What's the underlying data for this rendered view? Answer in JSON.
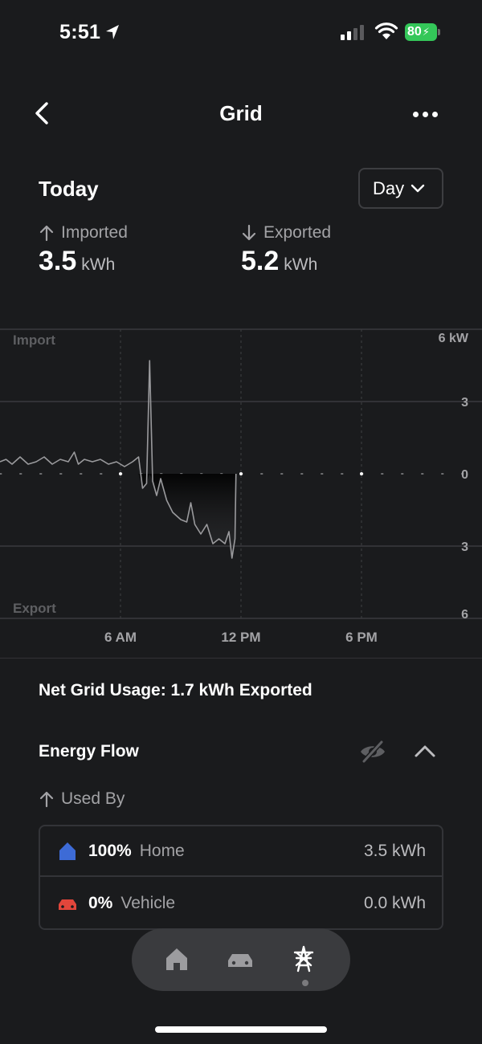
{
  "status": {
    "time": "5:51",
    "battery": "80"
  },
  "header": {
    "title": "Grid"
  },
  "period": {
    "label": "Today",
    "select_value": "Day"
  },
  "stats": {
    "imported": {
      "label": "Imported",
      "value": "3.5",
      "unit": "kWh"
    },
    "exported": {
      "label": "Exported",
      "value": "5.2",
      "unit": "kWh"
    }
  },
  "chart_data": {
    "type": "line",
    "top_label": "Import",
    "bottom_label": "Export",
    "y_unit": "kW",
    "ylim": [
      -6,
      6
    ],
    "y_ticks": [
      {
        "value": 6,
        "label": "6 kW"
      },
      {
        "value": 3,
        "label": "3"
      },
      {
        "value": 0,
        "label": "0"
      },
      {
        "value": -3,
        "label": "3"
      },
      {
        "value": -6,
        "label": "6"
      }
    ],
    "x_unit": "hour",
    "xlim": [
      0,
      24
    ],
    "x_ticks": [
      {
        "value": 6,
        "label": "6 AM"
      },
      {
        "value": 12,
        "label": "12 PM"
      },
      {
        "value": 18,
        "label": "6 PM"
      }
    ],
    "series": [
      {
        "color": "#9a9a9d",
        "points": [
          [
            0,
            0.5
          ],
          [
            0.3,
            0.6
          ],
          [
            0.6,
            0.4
          ],
          [
            1.0,
            0.7
          ],
          [
            1.4,
            0.4
          ],
          [
            1.8,
            0.5
          ],
          [
            2.2,
            0.7
          ],
          [
            2.6,
            0.4
          ],
          [
            3.0,
            0.6
          ],
          [
            3.4,
            0.5
          ],
          [
            3.7,
            0.9
          ],
          [
            3.9,
            0.4
          ],
          [
            4.2,
            0.6
          ],
          [
            4.6,
            0.5
          ],
          [
            5.0,
            0.6
          ],
          [
            5.4,
            0.4
          ],
          [
            5.8,
            0.5
          ],
          [
            6.2,
            0.3
          ],
          [
            6.6,
            0.5
          ],
          [
            6.9,
            0.7
          ],
          [
            7.1,
            -0.6
          ],
          [
            7.3,
            -0.4
          ],
          [
            7.45,
            4.7
          ],
          [
            7.6,
            -0.3
          ],
          [
            7.8,
            -0.9
          ],
          [
            8.0,
            -0.2
          ],
          [
            8.3,
            -1.1
          ],
          [
            8.6,
            -1.6
          ],
          [
            9.0,
            -1.9
          ],
          [
            9.3,
            -2.0
          ],
          [
            9.5,
            -1.2
          ],
          [
            9.7,
            -2.1
          ],
          [
            10.0,
            -2.5
          ],
          [
            10.3,
            -2.1
          ],
          [
            10.6,
            -2.9
          ],
          [
            10.9,
            -2.7
          ],
          [
            11.2,
            -2.9
          ],
          [
            11.4,
            -2.4
          ],
          [
            11.55,
            -3.5
          ],
          [
            11.7,
            -2.7
          ],
          [
            11.75,
            0
          ]
        ]
      }
    ]
  },
  "summary": {
    "net_usage": "Net Grid Usage: 1.7 kWh Exported",
    "energy_flow_title": "Energy Flow",
    "used_by_label": "Used By",
    "rows": [
      {
        "pct": "100%",
        "name": "Home",
        "value": "3.5 kWh",
        "icon": "home-icon",
        "color": "#3d6bd6"
      },
      {
        "pct": "0%",
        "name": "Vehicle",
        "value": "0.0 kWh",
        "icon": "car-icon",
        "color": "#e2463b"
      }
    ]
  },
  "colors": {
    "background": "#1a1b1d",
    "battery": "#34c759",
    "home": "#3d6bd6",
    "vehicle": "#e2463b"
  }
}
